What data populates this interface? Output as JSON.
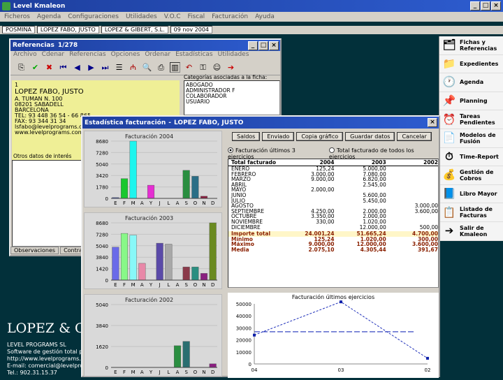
{
  "app": {
    "title": "Level Kmaleon",
    "menu": [
      "Ficheros",
      "Agenda",
      "Configuraciones",
      "Utilidades",
      "V.O.C",
      "Fiscal",
      "Facturación",
      "Ayuda"
    ],
    "context": [
      "POSMINA",
      "LOPEZ FABO, JUSTO",
      "LOPEZ & GIBERT, S.L.",
      "09 nov 2004"
    ]
  },
  "sidebar": [
    {
      "label": "Fichas y Referencias",
      "icon": "cards-icon"
    },
    {
      "label": "Expedientes",
      "icon": "folder-icon"
    },
    {
      "label": "Agenda",
      "icon": "clock-icon"
    },
    {
      "label": "Planning",
      "icon": "pin-icon"
    },
    {
      "label": "Tareas Pendientes",
      "icon": "alarm-icon"
    },
    {
      "label": "Modelos de Fusión",
      "icon": "document-icon"
    },
    {
      "label": "Time-Report",
      "icon": "time-report-icon"
    },
    {
      "label": "Gestión de Cobros",
      "icon": "coins-icon"
    },
    {
      "label": "Libro Mayor",
      "icon": "ledger-icon"
    },
    {
      "label": "Listado de Facturas",
      "icon": "invoice-list-icon"
    },
    {
      "label": "Salir de Kmaleon",
      "icon": "exit-icon"
    }
  ],
  "bottom": {
    "company": "LOPEZ & GI",
    "lines": [
      "LEVEL PROGRAMS SL",
      "Software de gestión total p",
      "http://www.levelprograms.com",
      "E-mail: comercial@levelprogram",
      "Tel.: 902.31.15.37"
    ]
  },
  "ref": {
    "title": "Referencias",
    "counter": "1/278",
    "menu": [
      "Archivo",
      "Cdenar",
      "Referencias",
      "Opciones",
      "Ordenar",
      "Estadísticas",
      "Utilidades"
    ],
    "record": {
      "n": "1",
      "name": "LOPEZ FABO, JUSTO",
      "lines": [
        "A. TUMAN N. 100",
        "08201 SABADELL",
        "BARCELONA",
        "TEL: 93 448 36 54 - 66 865",
        "FAX: 93 344 31 34",
        "lsfabo@levelprograms.com",
        "www.levelprograms.com"
      ]
    },
    "cat_label": "Categorías asociadas a la ficha:",
    "cats": [
      "ABOGADO",
      "ADMINISTRADOR F",
      "COLABORADOR",
      "USUARIO"
    ],
    "notes_label": "Otros datos de interés",
    "tabs": [
      "Observaciones",
      "Contratos"
    ]
  },
  "est": {
    "title": "Estadística facturación",
    "client": "LOPEZ FABO, JUSTO",
    "buttons": [
      "Saldos",
      "Enviado",
      "Copia gráfico",
      "Guardar datos",
      "Cancelar"
    ],
    "radios": [
      "Facturación últimos 3 ejercicios",
      "Total facturado de todos los ejercicios"
    ],
    "table_headers": [
      "Total facturado",
      "2004",
      "2003",
      "2002"
    ],
    "rows": [
      [
        "ENERO",
        "125,24",
        "5.000,00",
        ""
      ],
      [
        "FEBRERO",
        "3.000,00",
        "7.080,00",
        ""
      ],
      [
        "MARZO",
        "9.000,00",
        "6.820,00",
        ""
      ],
      [
        "ABRIL",
        "",
        "2.545,00",
        ""
      ],
      [
        "MAYO",
        "2.000,00",
        "",
        ""
      ],
      [
        "JUNIO",
        "",
        "5.600,00",
        ""
      ],
      [
        "JULIO",
        "",
        "5.450,00",
        ""
      ],
      [
        "AGOSTO",
        "",
        "",
        "3.000,00"
      ],
      [
        "SEPTIEMBRE",
        "4.250,00",
        "2.000,00",
        "3.600,00"
      ],
      [
        "OCTUBRE",
        "3.350,00",
        "2.000,00",
        ""
      ],
      [
        "NOVIEMBRE",
        "330,00",
        "1.020,00",
        ""
      ],
      [
        "DICIEMBRE",
        "",
        "12.000,00",
        "500,00"
      ]
    ],
    "totals": [
      [
        "Importe total",
        "24.001,24",
        "51.665,24",
        "4.700,00"
      ],
      [
        "Mínimo",
        "125,24",
        "1.020,00",
        "300,00"
      ],
      [
        "Máximo",
        "9.000,00",
        "12.000,00",
        "3.600,00"
      ],
      [
        "Media",
        "2.075,10",
        "4.305,44",
        "391,67"
      ]
    ],
    "line_title": "Facturación últimos ejercicios"
  },
  "chart_data": [
    {
      "type": "bar",
      "title": "Facturación 2004",
      "categories": [
        "E",
        "F",
        "M",
        "A",
        "Y",
        "J",
        "L",
        "A",
        "S",
        "O",
        "N",
        "D"
      ],
      "values": [
        125,
        3000,
        9000,
        0,
        2000,
        0,
        0,
        0,
        4250,
        3350,
        330,
        0
      ],
      "ylim": [
        0,
        8680
      ],
      "yticks": [
        "0",
        "1780",
        "3420",
        "5040",
        "7280",
        "8680"
      ],
      "colors": [
        "#3a4fb8",
        "#18c82e",
        "#1ef5ee",
        "#c8c8c8",
        "#e52ed2",
        "#c8c8c8",
        "#c8c8c8",
        "#c8c8c8",
        "#2a8e40",
        "#2a6e86",
        "#8a2040",
        "#5a7a20"
      ]
    },
    {
      "type": "bar",
      "title": "Facturación 2003",
      "categories": [
        "E",
        "F",
        "M",
        "A",
        "Y",
        "J",
        "L",
        "A",
        "S",
        "O",
        "N",
        "D"
      ],
      "values": [
        5000,
        7080,
        6820,
        2545,
        0,
        5600,
        5450,
        0,
        2000,
        2000,
        1020,
        12000
      ],
      "ylim": [
        0,
        8680
      ],
      "yticks": [
        "0",
        "1420",
        "3840",
        "5040",
        "7280",
        "8680"
      ],
      "colors": [
        "#6a6ae8",
        "#88f888",
        "#88f8f8",
        "#e888a8",
        "#c8c8c8",
        "#5a4aa8",
        "#a8a8a8",
        "#c8c8c8",
        "#8a3a4a",
        "#2a8e80",
        "#8a2080",
        "#6a8a20"
      ]
    },
    {
      "type": "bar",
      "title": "Facturación 2002",
      "categories": [
        "E",
        "F",
        "M",
        "A",
        "Y",
        "J",
        "L",
        "A",
        "S",
        "O",
        "N",
        "D"
      ],
      "values": [
        0,
        0,
        0,
        0,
        0,
        0,
        0,
        3000,
        3600,
        0,
        0,
        500
      ],
      "ylim": [
        0,
        8680
      ],
      "yticks": [
        "0",
        "1620",
        "3840",
        "5040"
      ],
      "colors": [
        "#c8c8c8",
        "#c8c8c8",
        "#c8c8c8",
        "#c8c8c8",
        "#c8c8c8",
        "#c8c8c8",
        "#c8c8c8",
        "#2a8e40",
        "#2a6e70",
        "#c8c8c8",
        "#c8c8c8",
        "#8a2080"
      ]
    },
    {
      "type": "line",
      "title": "Facturación últimos ejercicios",
      "x": [
        "04",
        "03",
        "02"
      ],
      "values": [
        24001.24,
        51665.24,
        4700
      ],
      "ylim": [
        0,
        50000
      ],
      "yticks": [
        "0",
        "10000",
        "20000",
        "30000",
        "40000",
        "50000"
      ],
      "avg": 26789
    }
  ]
}
